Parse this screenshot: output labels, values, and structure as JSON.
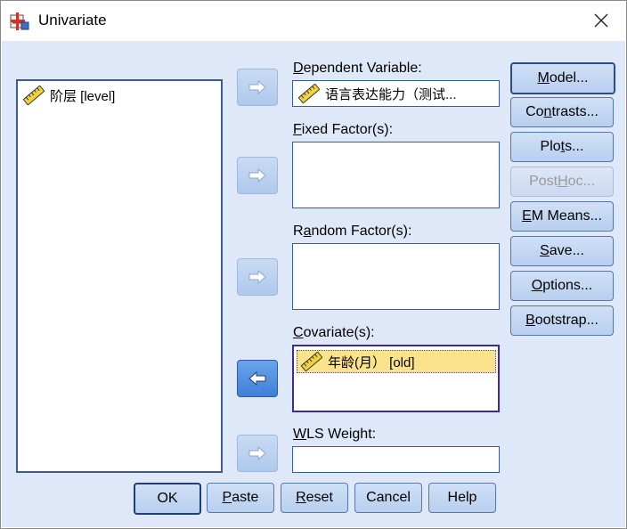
{
  "window": {
    "title": "Univariate",
    "icon": "spss-dialog-icon"
  },
  "source_list": {
    "items": [
      {
        "label": "阶层 [level]",
        "icon": "ruler-icon"
      }
    ]
  },
  "dependent": {
    "label_accel": "D",
    "label_rest": "ependent Variable:",
    "value": "语言表达能力（测试...",
    "icon": "ruler-icon"
  },
  "fixed": {
    "label_accel": "F",
    "label_rest": "ixed Factor(s):"
  },
  "random": {
    "label_pre": "R",
    "label_accel": "a",
    "label_rest": "ndom Factor(s):"
  },
  "covariates": {
    "label_accel": "C",
    "label_rest": "ovariate(s):",
    "items": [
      {
        "label": "年龄(月） [old]",
        "icon": "ruler-icon"
      }
    ]
  },
  "wls": {
    "label_accel": "W",
    "label_rest": "LS Weight:"
  },
  "side_buttons": {
    "model": {
      "pre": "",
      "accel": "M",
      "post": "odel..."
    },
    "contrasts": {
      "pre": "Co",
      "accel": "n",
      "post": "trasts..."
    },
    "plots": {
      "pre": "Plo",
      "accel": "t",
      "post": "s..."
    },
    "posthoc": {
      "pre": "Post ",
      "accel": "H",
      "post": "oc..."
    },
    "em_means": {
      "pre": "",
      "accel": "E",
      "post": "M Means..."
    },
    "save": {
      "pre": "",
      "accel": "S",
      "post": "ave..."
    },
    "options": {
      "pre": "",
      "accel": "O",
      "post": "ptions..."
    },
    "bootstrap": {
      "pre": "",
      "accel": "B",
      "post": "ootstrap..."
    }
  },
  "bottom_buttons": {
    "ok": "OK",
    "paste": {
      "accel": "P",
      "post": "aste"
    },
    "reset": {
      "accel": "R",
      "post": "eset"
    },
    "cancel": "Cancel",
    "help": "Help"
  },
  "colors": {
    "dialog_bg": "#dfe8f8",
    "selected_item_bg": "#fbe28c",
    "active_arrow": "#3f7fd6"
  }
}
